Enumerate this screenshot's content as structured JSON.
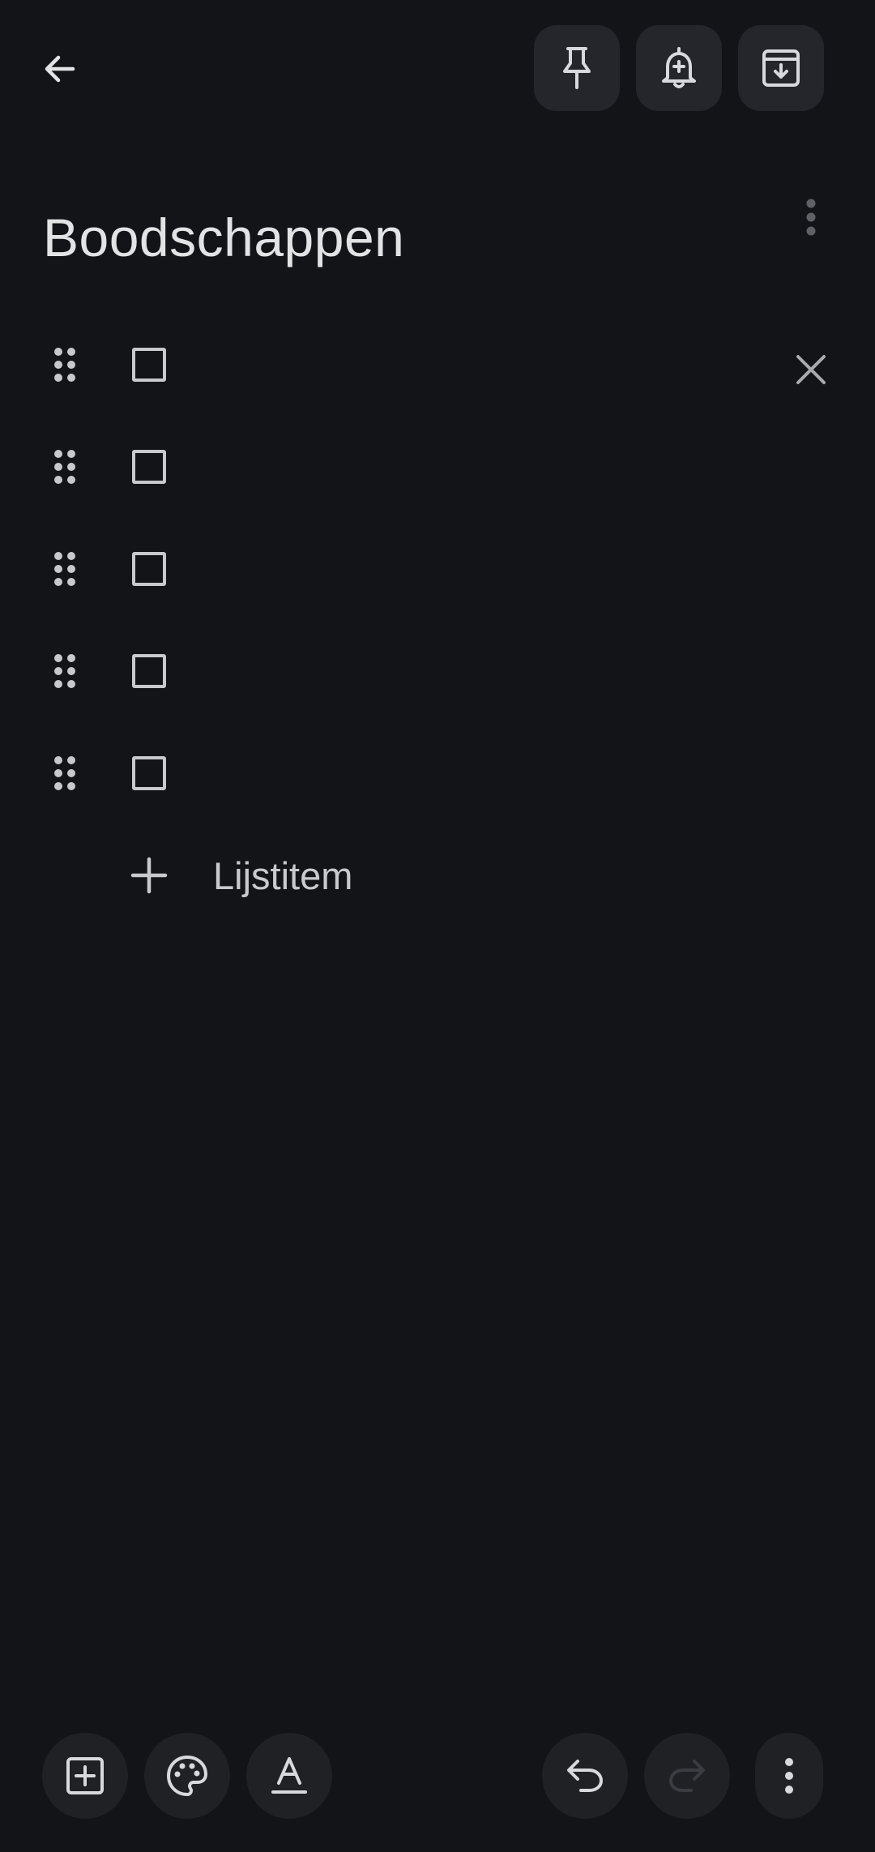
{
  "header": {
    "icons": {
      "back": "arrow-back-icon",
      "pin": "pin-icon",
      "reminder": "bell-plus-icon",
      "archive": "archive-icon"
    }
  },
  "note": {
    "title": "Boodschappen",
    "items": [
      {
        "text": "",
        "checked": false
      },
      {
        "text": "",
        "checked": false
      },
      {
        "text": "",
        "checked": false
      },
      {
        "text": "",
        "checked": false
      },
      {
        "text": "",
        "checked": false
      }
    ],
    "add_item_label": "Lijstitem"
  },
  "toolbar": {
    "icons": [
      "add-box-icon",
      "palette-icon",
      "text-format-icon",
      "undo-icon",
      "redo-icon",
      "more-vertical-icon"
    ]
  },
  "colors": {
    "background": "#131418",
    "surface": "#24262b",
    "text": "#e3e3e6",
    "icon": "#c8c9cd"
  }
}
